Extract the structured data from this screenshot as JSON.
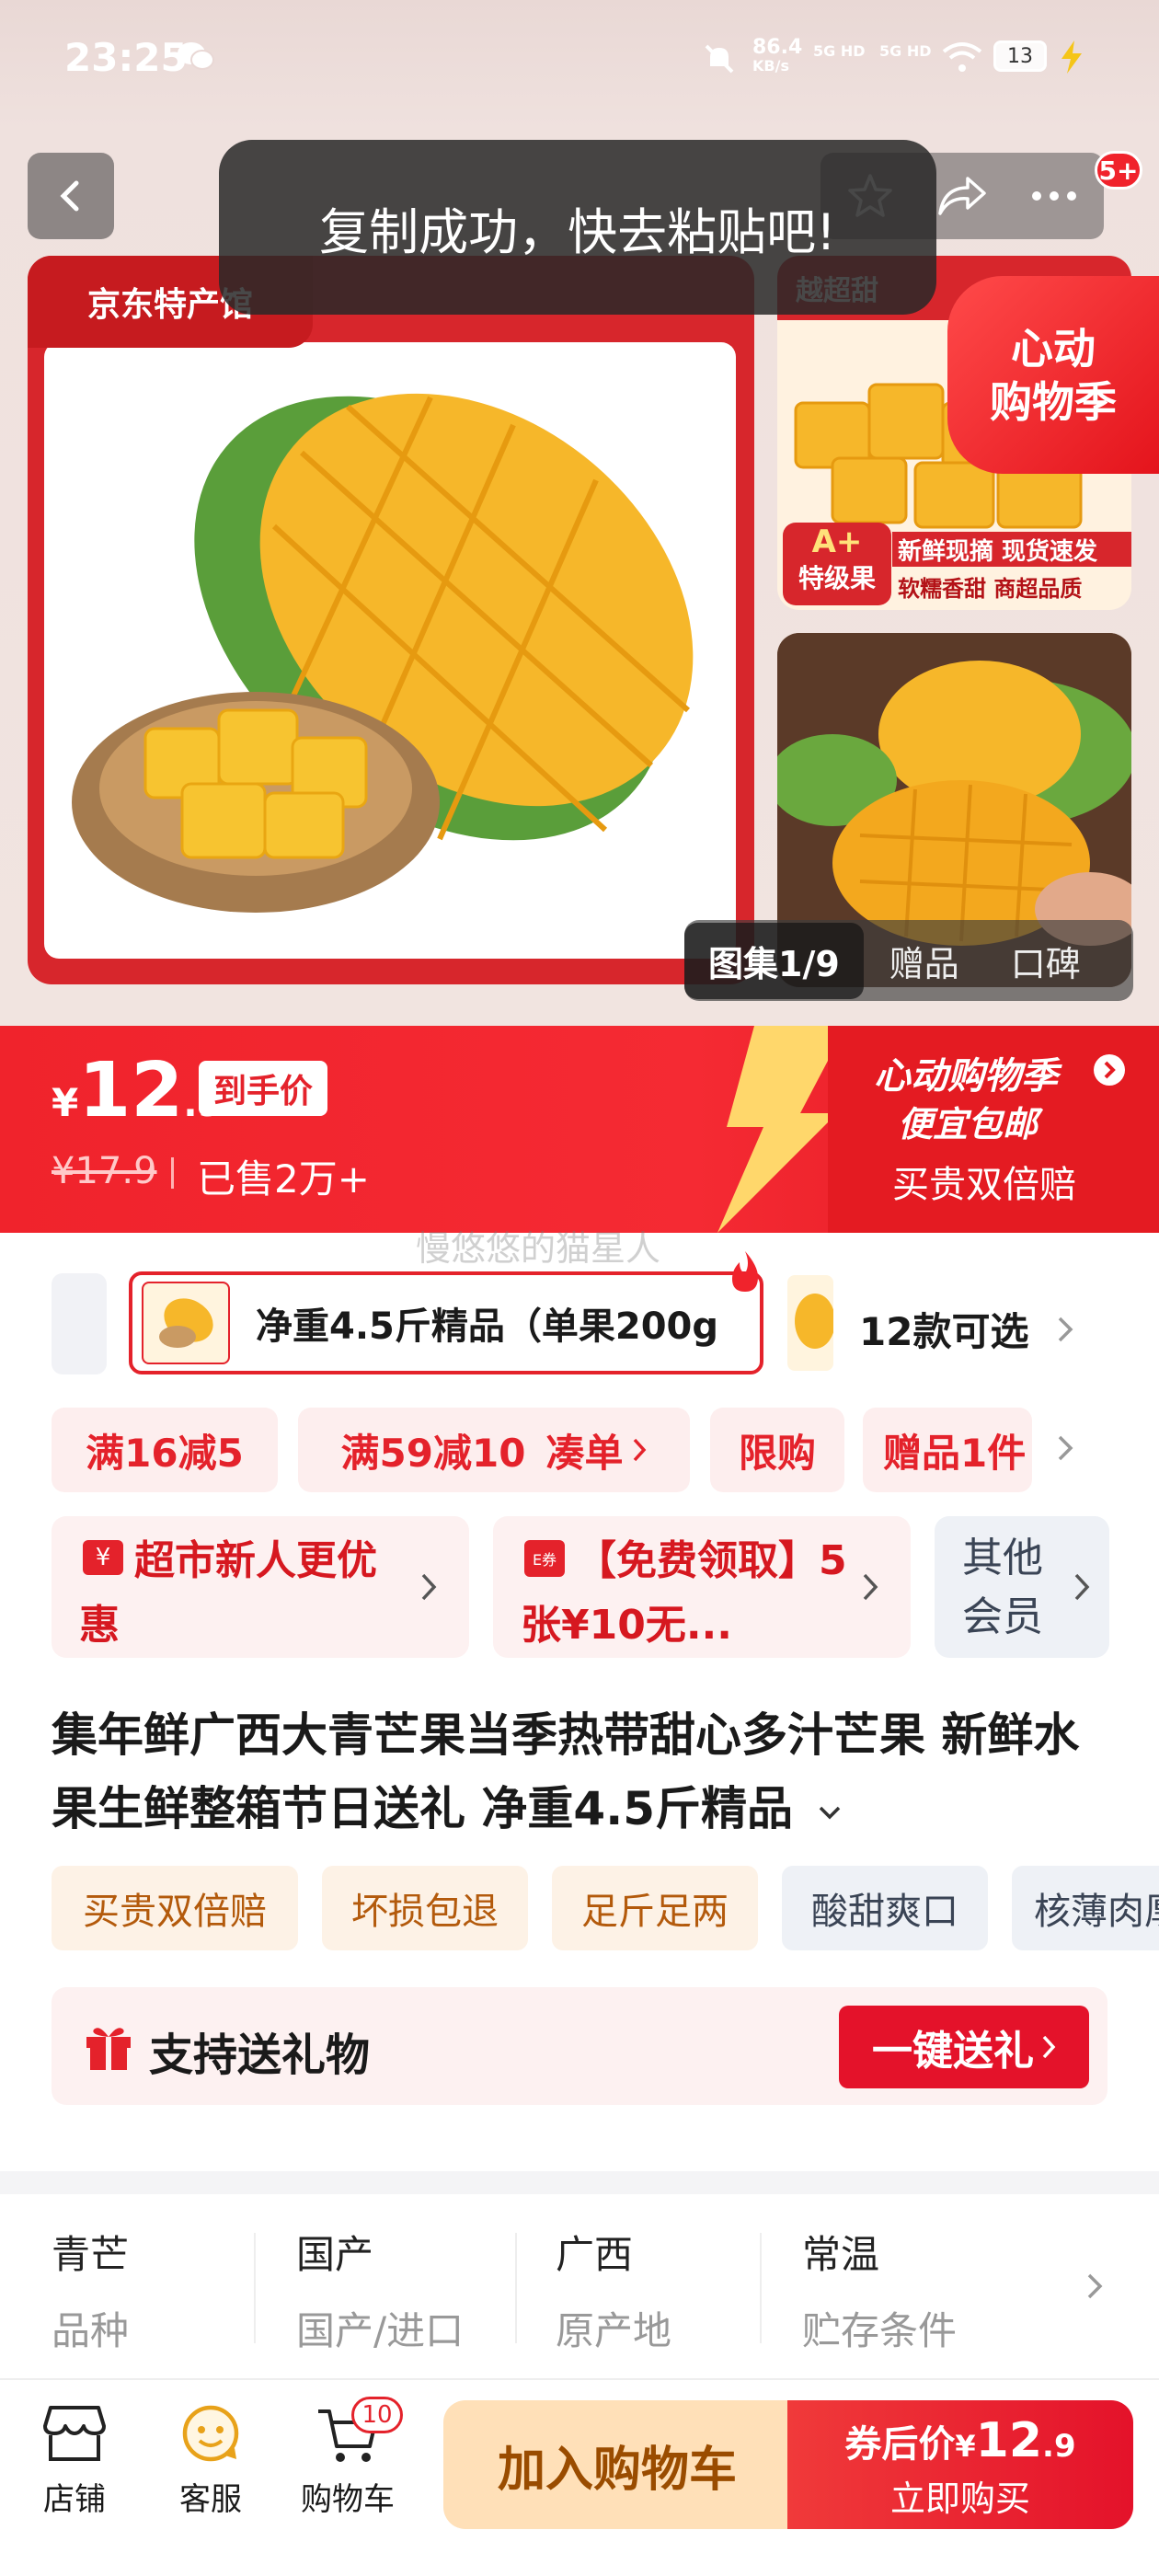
{
  "status_bar": {
    "time": "23:25",
    "net_speed": "86.4",
    "net_unit": "KB/s",
    "sig1": "5G HD",
    "sig2": "5G HD",
    "battery": "13"
  },
  "nav": {
    "cart_badge": "5+"
  },
  "toast": "复制成功，快去粘贴吧!",
  "hero": {
    "brand": "京东特产馆",
    "promo_badge_line1": "心动",
    "promo_badge_line2": "购物季",
    "thumb_top_label1": "A+",
    "thumb_top_label2": "特级果",
    "thumb_top_caption1": "新鲜现摘 现货速发",
    "thumb_top_caption2": "软糯香甜 商超品质",
    "thumb_top_head": "越超甜",
    "gallery_tabs": [
      "图集1/9",
      "赠品",
      "口碑"
    ]
  },
  "price": {
    "currency": "¥",
    "int": "12",
    "dec": ".9",
    "label": "到手价",
    "original": "¥17.9",
    "sold": "已售2万+",
    "promo_line1": "心动购物季",
    "promo_line2": "便宜包邮",
    "promo_line3": "买贵双倍赔",
    "watermark": "慢悠悠的猫星人"
  },
  "variant": {
    "selected": "净重4.5斤精品（单果200g",
    "count": "12款可选"
  },
  "coupons": [
    "满16减5",
    "满59减10",
    "凑单",
    "限购",
    "赠品1件"
  ],
  "benefits": [
    {
      "icon_text": "¥",
      "text": "超市新人更优惠"
    },
    {
      "icon_text": "E券",
      "text": "【免费领取】5张¥10无..."
    },
    {
      "text": "其他会员"
    }
  ],
  "title": "集年鲜广西大青芒果当季热带甜心多汁芒果 新鲜水果生鲜整箱节日送礼 净重4.5斤精品",
  "tags": [
    {
      "text": "买贵双倍赔",
      "style": "y"
    },
    {
      "text": "坏损包退",
      "style": "y"
    },
    {
      "text": "足斤足两",
      "style": "y"
    },
    {
      "text": "酸甜爽口",
      "style": "g"
    },
    {
      "text": "核薄肉厚",
      "style": "g"
    }
  ],
  "gift": {
    "label": "支持送礼物",
    "button": "一键送礼"
  },
  "specs": [
    {
      "value": "青芒",
      "key": "品种"
    },
    {
      "value": "国产",
      "key": "国产/进口"
    },
    {
      "value": "广西",
      "key": "原产地"
    },
    {
      "value": "常温",
      "key": "贮存条件"
    }
  ],
  "bottom": {
    "shop": "店铺",
    "service": "客服",
    "cart": "购物车",
    "cart_badge": "10",
    "add_cart": "加入购物车",
    "buy_prefix": "券后价",
    "buy_currency": "¥",
    "buy_int": "12",
    "buy_dec": ".9",
    "buy_now": "立即购买"
  },
  "colors": {
    "primary": "#f0232c",
    "accent_yellow": "#ffe0b8",
    "text_gray": "#999999"
  }
}
